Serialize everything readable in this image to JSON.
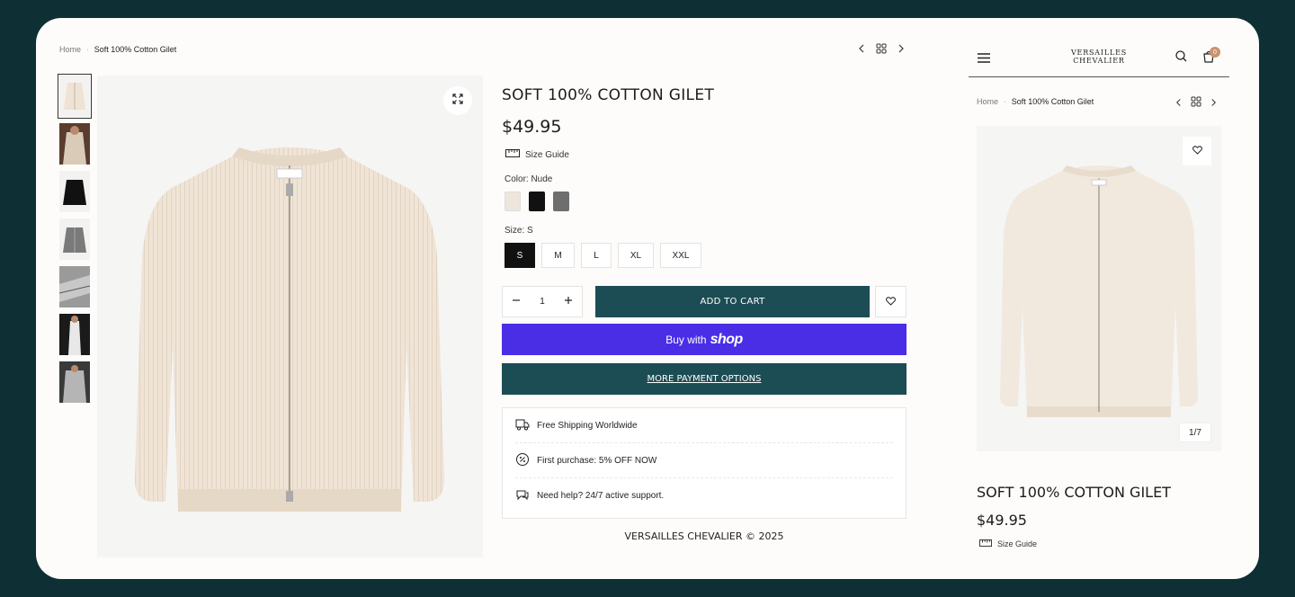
{
  "breadcrumb": {
    "home": "Home",
    "separator": "·",
    "current": "Soft 100% Cotton Gilet"
  },
  "product": {
    "title": "SOFT 100% COTTON GILET",
    "price": "$49.95",
    "size_guide": "Size Guide",
    "color_label": "Color: Nude",
    "colors": [
      {
        "name": "Nude",
        "hex": "#efe6db"
      },
      {
        "name": "Black",
        "hex": "#111111"
      },
      {
        "name": "Grey",
        "hex": "#6e6e6e"
      }
    ],
    "size_label": "Size: S",
    "sizes": [
      "S",
      "M",
      "L",
      "XL",
      "XXL"
    ],
    "selected_size": "S",
    "quantity": "1",
    "add_to_cart": "ADD TO CART",
    "buy_with": "Buy with",
    "shop_brand": "shop",
    "more_payment": "MORE PAYMENT OPTIONS"
  },
  "perks": [
    {
      "icon": "truck-icon",
      "text": "Free Shipping Worldwide"
    },
    {
      "icon": "discount-badge-icon",
      "text": "First purchase: 5% OFF NOW"
    },
    {
      "icon": "support-chat-icon",
      "text": "Need help? 24/7 active support."
    }
  ],
  "footer": "VERSAILLES CHEVALIER © 2025",
  "mobile": {
    "logo_line1": "VERSAILLES",
    "logo_line2": "CHEVALIER",
    "cart_count": "0",
    "image_counter": "1/7"
  },
  "colors": {
    "frame_bg": "#0e2f33",
    "primary": "#1d4d54",
    "shop_pay": "#4a2ee6"
  }
}
